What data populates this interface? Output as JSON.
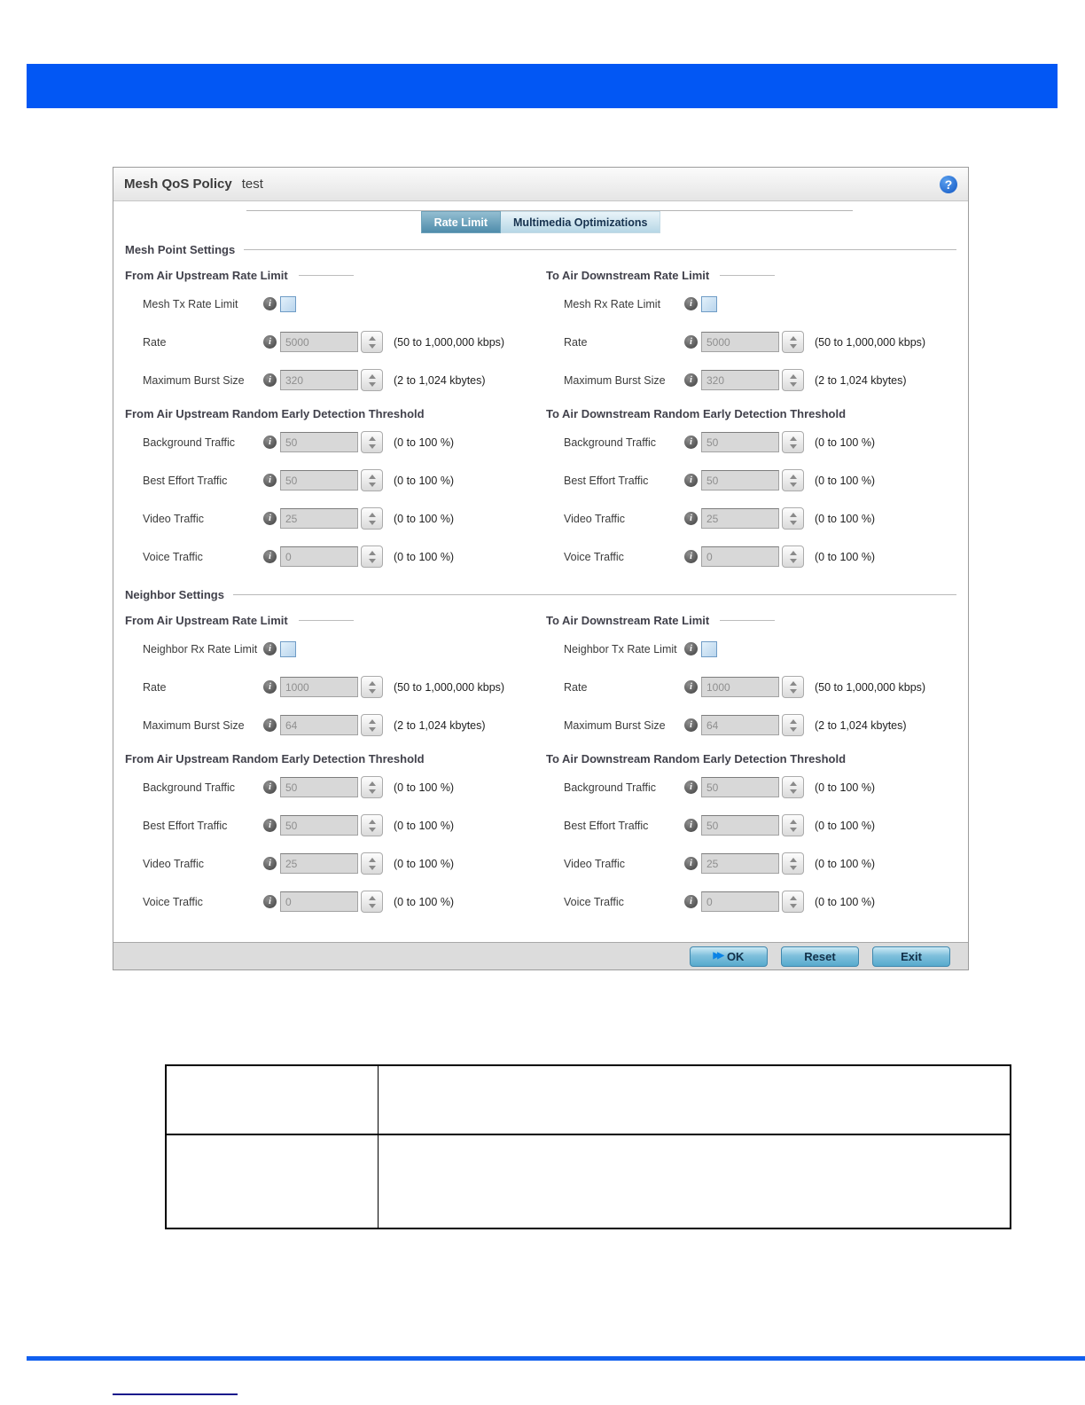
{
  "colors": {
    "top_banner_blue": "#0257f4",
    "bottom_rule_blue": "#1160ef",
    "footnote_rule_navy": "#1a1a8c",
    "active_tab_blue": "#4f8cab",
    "button_blue": "#7fc0dc",
    "help_icon_blue": "#1257c4"
  },
  "dialog": {
    "title": "Mesh QoS Policy",
    "policy_name": "test",
    "tabs": [
      {
        "label": "Rate Limit",
        "active": true
      },
      {
        "label": "Multimedia Optimizations",
        "active": false
      }
    ],
    "groups": {
      "mesh_point": {
        "title": "Mesh Point Settings",
        "upstream": {
          "heading": "From Air Upstream Rate Limit",
          "enable": {
            "label": "Mesh Tx Rate Limit",
            "checked": false
          },
          "rate": {
            "label": "Rate",
            "value": "5000",
            "hint": "(50 to 1,000,000 kbps)"
          },
          "burst": {
            "label": "Maximum Burst Size",
            "value": "320",
            "hint": "(2 to 1,024 kbytes)"
          },
          "red_heading": "From Air Upstream Random Early Detection Threshold",
          "red": [
            {
              "label": "Background Traffic",
              "value": "50",
              "hint": "(0 to 100 %)"
            },
            {
              "label": "Best Effort Traffic",
              "value": "50",
              "hint": "(0 to 100 %)"
            },
            {
              "label": "Video Traffic",
              "value": "25",
              "hint": "(0 to 100 %)"
            },
            {
              "label": "Voice Traffic",
              "value": "0",
              "hint": "(0 to 100 %)"
            }
          ]
        },
        "downstream": {
          "heading": "To Air Downstream Rate Limit",
          "enable": {
            "label": "Mesh Rx Rate Limit",
            "checked": false
          },
          "rate": {
            "label": "Rate",
            "value": "5000",
            "hint": "(50 to 1,000,000 kbps)"
          },
          "burst": {
            "label": "Maximum Burst Size",
            "value": "320",
            "hint": "(2 to 1,024 kbytes)"
          },
          "red_heading": "To Air Downstream Random Early Detection Threshold",
          "red": [
            {
              "label": "Background Traffic",
              "value": "50",
              "hint": "(0 to 100 %)"
            },
            {
              "label": "Best Effort Traffic",
              "value": "50",
              "hint": "(0 to 100 %)"
            },
            {
              "label": "Video Traffic",
              "value": "25",
              "hint": "(0 to 100 %)"
            },
            {
              "label": "Voice Traffic",
              "value": "0",
              "hint": "(0 to 100 %)"
            }
          ]
        }
      },
      "neighbor": {
        "title": "Neighbor Settings",
        "upstream": {
          "heading": "From Air Upstream Rate Limit",
          "enable": {
            "label": "Neighbor Rx Rate Limit",
            "checked": false
          },
          "rate": {
            "label": "Rate",
            "value": "1000",
            "hint": "(50 to 1,000,000 kbps)"
          },
          "burst": {
            "label": "Maximum Burst Size",
            "value": "64",
            "hint": "(2 to 1,024 kbytes)"
          },
          "red_heading": "From Air Upstream Random Early Detection Threshold",
          "red": [
            {
              "label": "Background Traffic",
              "value": "50",
              "hint": "(0 to 100 %)"
            },
            {
              "label": "Best Effort Traffic",
              "value": "50",
              "hint": "(0 to 100 %)"
            },
            {
              "label": "Video Traffic",
              "value": "25",
              "hint": "(0 to 100 %)"
            },
            {
              "label": "Voice Traffic",
              "value": "0",
              "hint": "(0 to 100 %)"
            }
          ]
        },
        "downstream": {
          "heading": "To Air Downstream Rate Limit",
          "enable": {
            "label": "Neighbor Tx Rate Limit",
            "checked": false
          },
          "rate": {
            "label": "Rate",
            "value": "1000",
            "hint": "(50 to 1,000,000 kbps)"
          },
          "burst": {
            "label": "Maximum Burst Size",
            "value": "64",
            "hint": "(2 to 1,024 kbytes)"
          },
          "red_heading": "To Air Downstream Random Early Detection Threshold",
          "red": [
            {
              "label": "Background Traffic",
              "value": "50",
              "hint": "(0 to 100 %)"
            },
            {
              "label": "Best Effort Traffic",
              "value": "50",
              "hint": "(0 to 100 %)"
            },
            {
              "label": "Video Traffic",
              "value": "25",
              "hint": "(0 to 100 %)"
            },
            {
              "label": "Voice Traffic",
              "value": "0",
              "hint": "(0 to 100 %)"
            }
          ]
        }
      }
    },
    "footer": {
      "ok": "OK",
      "reset": "Reset",
      "exit": "Exit"
    }
  },
  "bottom_table": {
    "rows": [
      [
        "",
        ""
      ],
      [
        "",
        ""
      ]
    ]
  }
}
